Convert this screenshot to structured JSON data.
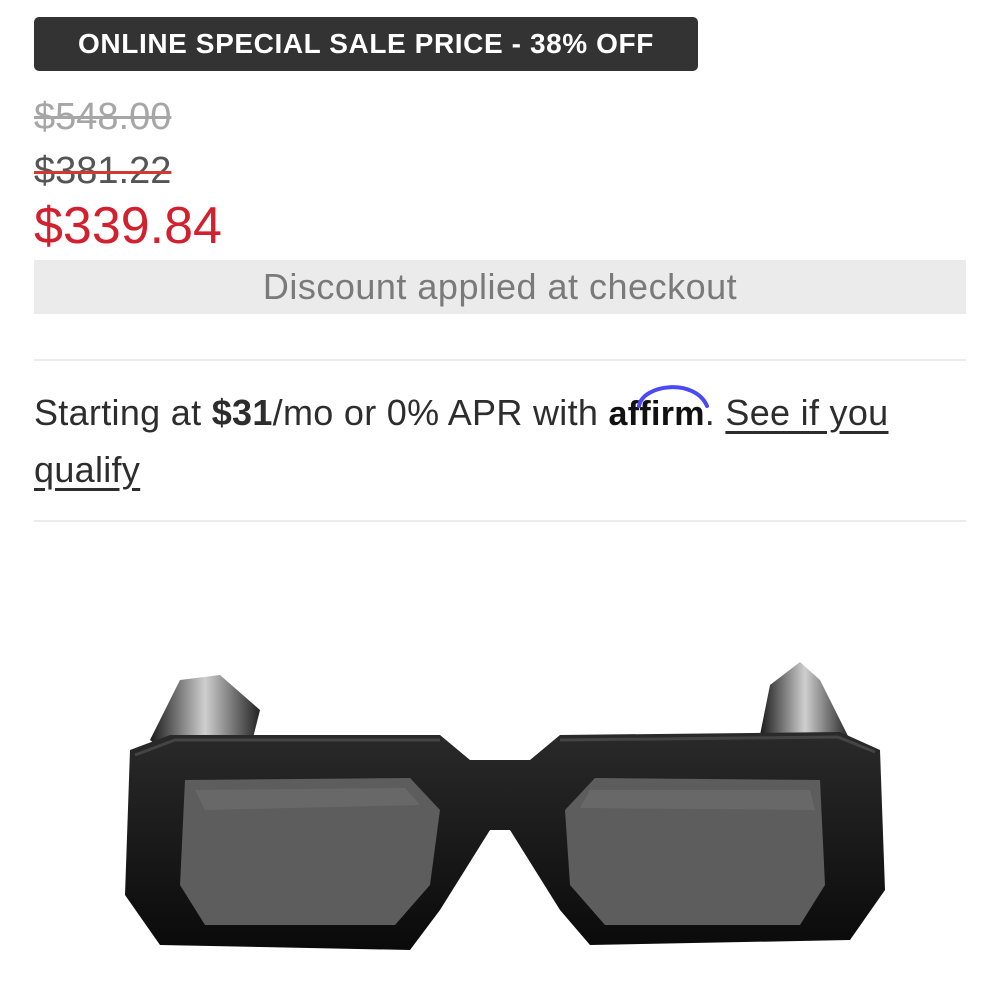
{
  "sale_badge": "ONLINE SPECIAL SALE PRICE - 38% OFF",
  "prices": {
    "original": "$548.00",
    "previous": "$381.22",
    "final": "$339.84"
  },
  "discount_note": "Discount applied at checkout",
  "financing": {
    "prefix": "Starting at ",
    "amount": "$31",
    "middle": "/mo or 0% APR with ",
    "brand": "affirm",
    "period": ".",
    "link_text": "See if you qualify"
  },
  "product_image": {
    "icon": "sunglasses-image"
  },
  "colors": {
    "badge_bg": "#333333",
    "sale_price": "#d3202e",
    "strike_red": "#d23a2e",
    "affirm_blue": "#4a4af4"
  }
}
